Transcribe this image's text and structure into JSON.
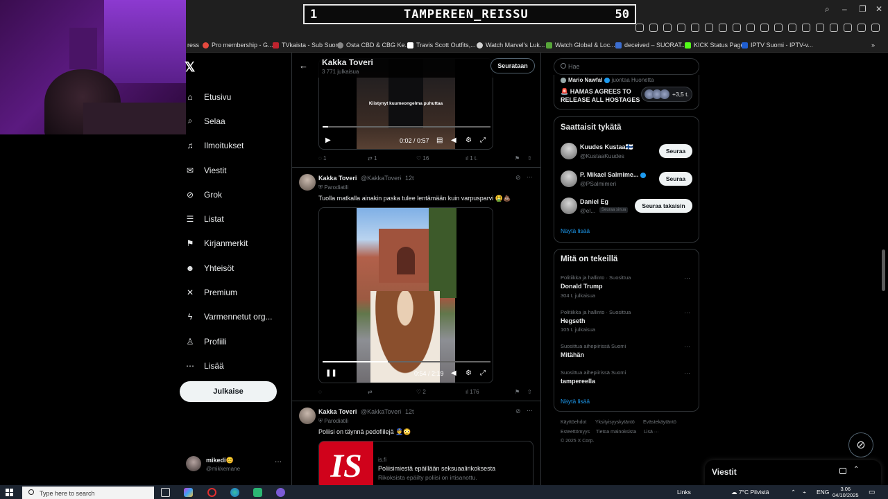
{
  "stream_overlay": {
    "left_num": "1",
    "title": "TAMPEREEN_REISSU",
    "right_num": "50"
  },
  "bookmarks": [
    {
      "label": "ress",
      "color": "#000000"
    },
    {
      "label": "Pro membership - G...",
      "color": "#e4493e"
    },
    {
      "label": "TVkaista - Sub Suora",
      "color": "#c0232e"
    },
    {
      "label": "Osta CBD & CBG Ke...",
      "color": "#888888"
    },
    {
      "label": "Travis Scott Outfits,...",
      "color": "#ffffff"
    },
    {
      "label": "Watch Marvel's Luk...",
      "color": "#d0d0d0"
    },
    {
      "label": "Watch Global & Loc...",
      "color": "#57a639"
    },
    {
      "label": "deceived – SUORAT...",
      "color": "#3b6ed1"
    },
    {
      "label": "KICK Status Page",
      "color": "#53fc18"
    },
    {
      "label": "IPTV Suomi - IPTV-v...",
      "color": "#1f5ed1"
    }
  ],
  "nav": {
    "items": [
      {
        "label": "Etusivu",
        "icon": "home-icon"
      },
      {
        "label": "Selaa",
        "icon": "search-icon"
      },
      {
        "label": "Ilmoitukset",
        "icon": "bell-icon"
      },
      {
        "label": "Viestit",
        "icon": "mail-icon"
      },
      {
        "label": "Grok",
        "icon": "grok-icon"
      },
      {
        "label": "Listat",
        "icon": "list-icon"
      },
      {
        "label": "Kirjanmerkit",
        "icon": "bookmark-icon"
      },
      {
        "label": "Yhteisöt",
        "icon": "communities-icon"
      },
      {
        "label": "Premium",
        "icon": "x-icon"
      },
      {
        "label": "Varmennetut org...",
        "icon": "lightning-icon"
      },
      {
        "label": "Profiili",
        "icon": "person-icon"
      },
      {
        "label": "Lisää",
        "icon": "more-circle-icon"
      }
    ],
    "post_button": "Julkaise"
  },
  "me": {
    "name": "mikedi😊",
    "handle": "@mikkemane"
  },
  "profile_header": {
    "name": "Kakka Toveri",
    "count": "3 771 julkaisua",
    "follow_label": "Seurataan"
  },
  "video1": {
    "caption": "Kiistynyt kuumeongelma puhuttaa",
    "time": "0:02 / 0:57",
    "progress": 0.035
  },
  "tweet1_actions": {
    "replies": "1",
    "retweets": "1",
    "likes": "16",
    "views": "1 t."
  },
  "tweet2": {
    "name": "Kakka Toveri",
    "handle": "@KakkaToveri",
    "age": "12t",
    "label": "Parodiatili",
    "text": "Tuolla matkalla ainakin paska tulee lentämään kuin varpusparvi 🤮💩",
    "video_time": "0:54 / 2:19",
    "progress": 0.39,
    "actions": {
      "likes": "2",
      "views": "176"
    }
  },
  "tweet3": {
    "name": "Kakka Toveri",
    "handle": "@KakkaToveri",
    "age": "12t",
    "label": "Parodiatili",
    "text": "Poliisi on täynnä pedofiilejä 👮😳",
    "card": {
      "logo": "IS",
      "domain": "is.fi",
      "title": "Poliisimiestä epäillään seksuaalirikoksesta",
      "desc": "Rikoksista epäilty poliisi on irtisanottu."
    }
  },
  "search": {
    "placeholder": "Hae"
  },
  "news": {
    "author": "Mario Nawfal",
    "suffix": "juontaa Huonetta",
    "headline_1": "🚨 HAMAS AGREES TO",
    "headline_2": "RELEASE ALL HOSTAGES",
    "listeners": "+3,5 t."
  },
  "suggestions": {
    "title": "Saattaisit tykätä",
    "items": [
      {
        "name": "Kuudes Kustaa🇫🇮",
        "handle": "@KustaaKuudes",
        "button": "Seuraa"
      },
      {
        "name": "P. Mikael Salmime...",
        "handle": "@PSalmimeri",
        "button": "Seuraa"
      },
      {
        "name": "Daniel Eg",
        "handle": "@el...",
        "badge": "Seuraa sinua",
        "button": "Seuraa takaisin"
      }
    ],
    "more": "Näytä lisää"
  },
  "trends": {
    "title": "Mitä on tekeillä",
    "items": [
      {
        "category": "Politiikka ja hallinto · Suosittua",
        "name": "Donald Trump",
        "count": "304 t. julkaisua"
      },
      {
        "category": "Politiikka ja hallinto · Suosittua",
        "name": "Hegseth",
        "count": "105 t. julkaisua"
      },
      {
        "category": "Suosittua aihepiirissä Suomi",
        "name": "Mitähän",
        "count": ""
      },
      {
        "category": "Suosittua aihepiirissä Suomi",
        "name": "tampereella",
        "count": ""
      }
    ],
    "more": "Näytä lisää"
  },
  "footer": {
    "l1": "Käyttöehdot",
    "l2": "Yksityisyyskytäntö",
    "l3": "Evästekäytäntö",
    "l4": "Esteettömyys",
    "l5": "Tietoa mainoksista",
    "l6": "Lisä ···",
    "copyright": "© 2025 X Corp."
  },
  "messages_dock": {
    "title": "Viestit"
  },
  "taskbar": {
    "search_placeholder": "Type here to search",
    "links": "Links",
    "weather": "7°C Pilvistä",
    "lang": "ENG",
    "time": "3.06",
    "date": "04/10/2025"
  }
}
